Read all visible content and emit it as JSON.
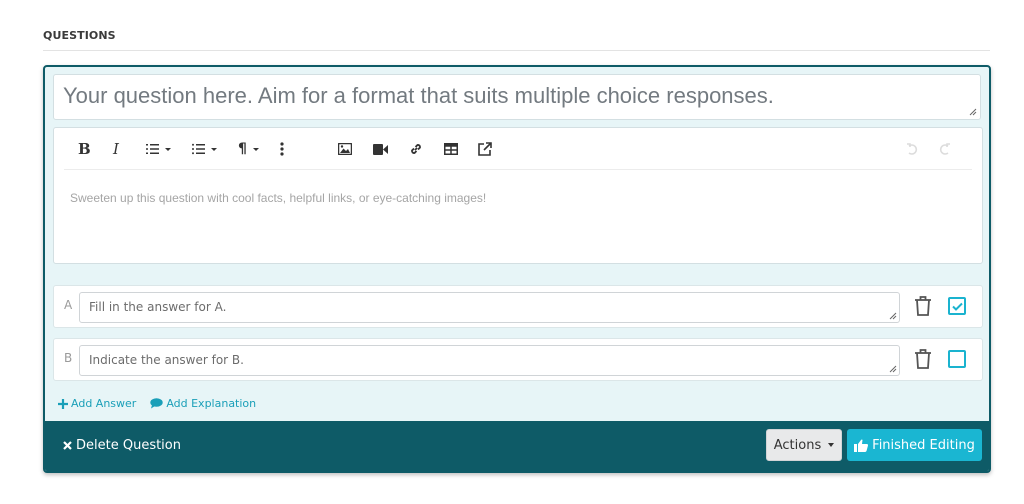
{
  "section": {
    "title": "QUESTIONS"
  },
  "question": {
    "placeholder": "Your question here. Aim for a format that suits multiple choice responses.",
    "value": ""
  },
  "editor": {
    "toolbar": {
      "bold": "B",
      "italic": "I",
      "paragraph": "¶",
      "icons": [
        "bold-icon",
        "italic-icon",
        "ordered-list-icon",
        "unordered-list-icon",
        "paragraph-icon",
        "more-icon",
        "image-icon",
        "video-icon",
        "link-icon",
        "table-icon",
        "external-link-icon",
        "undo-icon",
        "redo-icon"
      ]
    },
    "placeholder": "Sweeten up this question with cool facts, helpful links, or eye-catching images!"
  },
  "answers": [
    {
      "letter": "A",
      "placeholder": "Fill in the answer for A.",
      "correct": true
    },
    {
      "letter": "B",
      "placeholder": "Indicate the answer for B.",
      "correct": false
    }
  ],
  "links": {
    "add_answer": "Add Answer",
    "add_explanation": "Add Explanation"
  },
  "footer": {
    "delete": "Delete Question",
    "actions": "Actions",
    "finished": "Finished Editing"
  },
  "colors": {
    "primary": "#0e5b67",
    "accent": "#1ab6d2",
    "card_bg": "#e7f5f7"
  }
}
